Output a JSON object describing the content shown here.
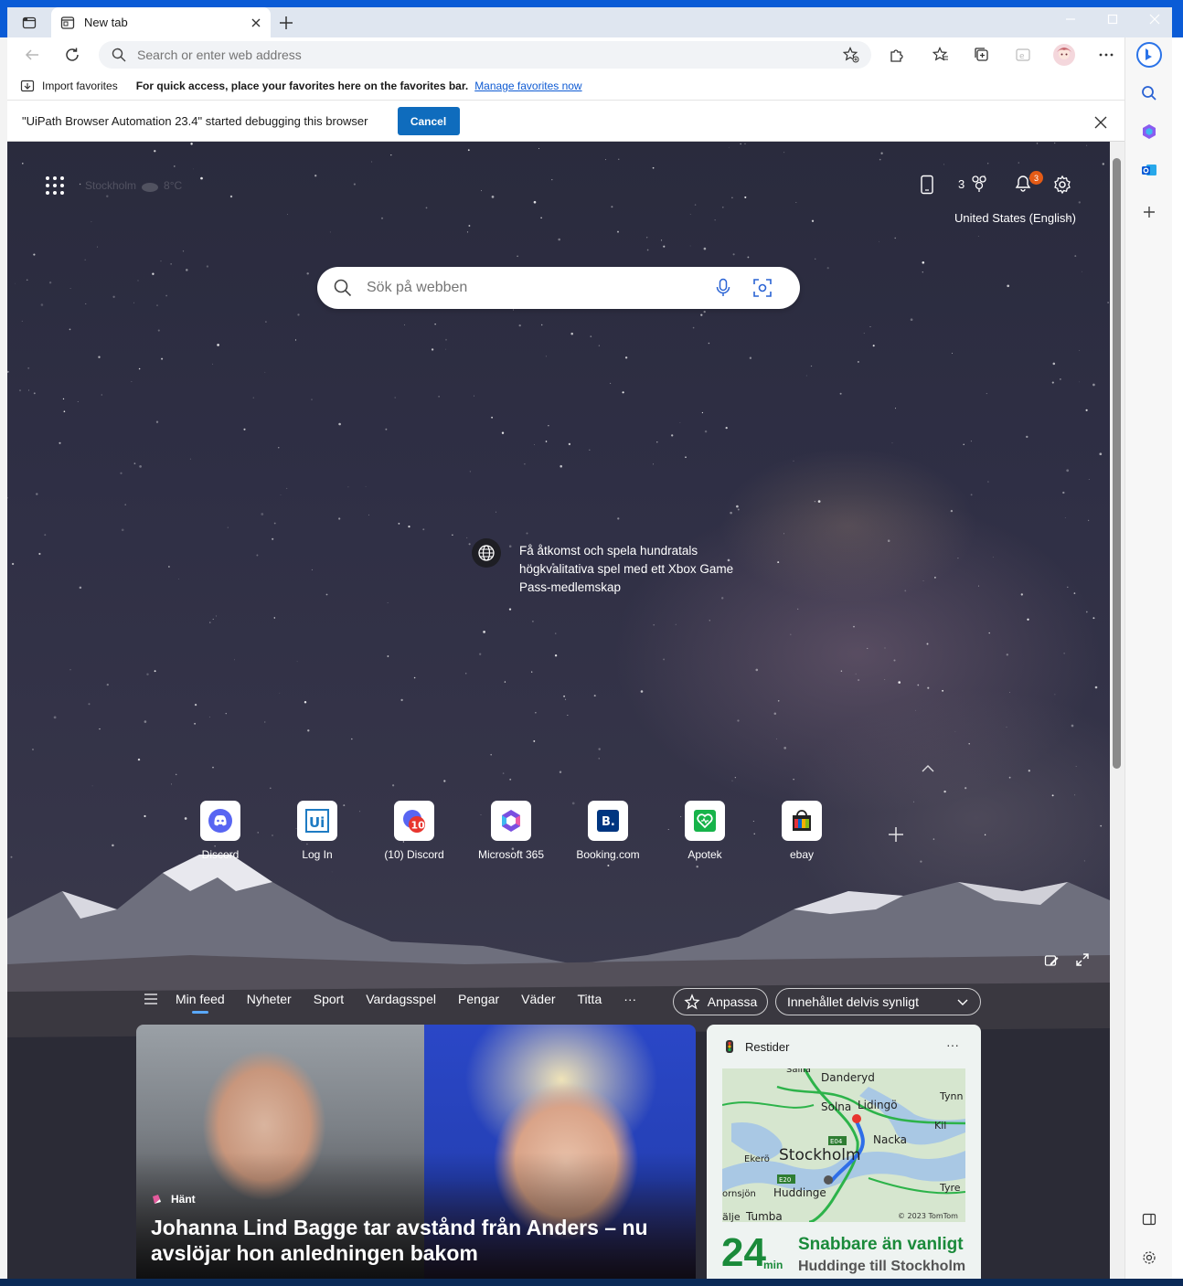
{
  "browser": {
    "tab_title": "New tab",
    "address_placeholder": "Search or enter web address",
    "window_controls": [
      "minimize-icon",
      "maximize-icon",
      "close-icon"
    ]
  },
  "favorites_bar": {
    "import_label": "Import favorites",
    "hint": "For quick access, place your favorites here on the favorites bar.",
    "manage_link": "Manage favorites now"
  },
  "infobar": {
    "message": "\"UiPath Browser Automation 23.4\" started debugging this browser",
    "cancel_label": "Cancel"
  },
  "page": {
    "weather_city": "Stockholm",
    "weather_temp": "8°C",
    "rewards_points": "3",
    "notifications_count": "3",
    "locale": "United States (English)",
    "search_placeholder": "Sök på webben",
    "promo_text": "Få åtkomst och spela hundratals högkvalitativa spel med ett Xbox Game Pass-medlemskap"
  },
  "quick_links": [
    {
      "label": "Discord",
      "icon": "discord-icon",
      "color": "#5865f2"
    },
    {
      "label": "Log In",
      "icon": "uipath-icon",
      "color": "#1e7bc3"
    },
    {
      "label": "(10) Discord",
      "icon": "discord-notification-icon",
      "color": "#e8352e"
    },
    {
      "label": "Microsoft 365",
      "icon": "microsoft365-icon",
      "color": "#7a4fe0"
    },
    {
      "label": "Booking.com",
      "icon": "booking-icon",
      "color": "#003580"
    },
    {
      "label": "Apotek",
      "icon": "apotek-icon",
      "color": "#17b34a"
    },
    {
      "label": "ebay",
      "icon": "ebay-icon",
      "color": "#e53238"
    }
  ],
  "feed_nav": {
    "items": [
      "Min feed",
      "Nyheter",
      "Sport",
      "Vardagsspel",
      "Pengar",
      "Väder",
      "Titta"
    ],
    "more": "···",
    "customize_label": "Anpassa",
    "visibility_label": "Innehållet delvis synligt"
  },
  "news_card": {
    "source": "Hänt",
    "headline": "Johanna Lind Bagge tar avstånd från Anders – nu avslöjar hon anledningen bakom"
  },
  "traffic_card": {
    "title": "Restider",
    "more": "···",
    "map_labels": [
      "Danderyd",
      "Solna",
      "Lidingö",
      "Tynn",
      "Kil",
      "Nacka",
      "Stockholm",
      "Ekerö",
      "Huddinge",
      "Tyre",
      "ornsjön",
      "älje",
      "Tumba",
      "Sallla"
    ],
    "map_copyright": "© 2023 TomTom",
    "road_labels": [
      "E04",
      "E20"
    ],
    "minutes": "24",
    "minutes_unit": "min",
    "status": "Snabbare än vanligt",
    "route": "Huddinge till Stockholm"
  }
}
